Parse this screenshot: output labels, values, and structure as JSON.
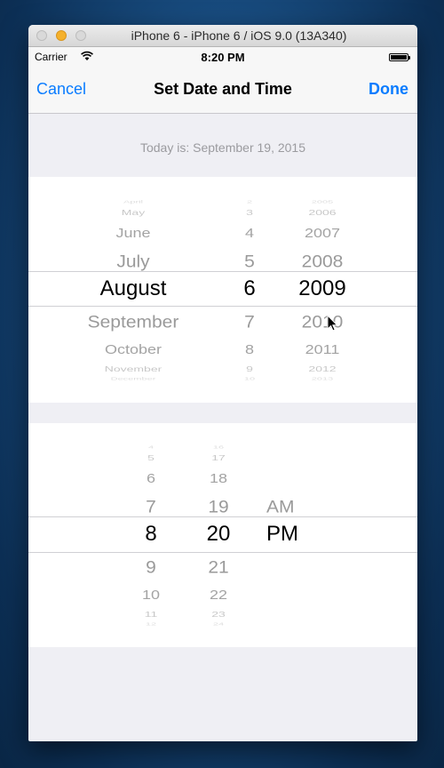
{
  "window": {
    "title": "iPhone 6 - iPhone 6 / iOS 9.0 (13A340)"
  },
  "status_bar": {
    "carrier": "Carrier",
    "time": "8:20 PM",
    "wifi_icon": "wifi-icon",
    "battery_icon": "battery-icon"
  },
  "nav": {
    "cancel": "Cancel",
    "title": "Set Date and Time",
    "done": "Done",
    "accent": "#0a7cff"
  },
  "today_label": "Today is: September 19, 2015",
  "date_picker": {
    "months": [
      "April",
      "May",
      "June",
      "July",
      "August",
      "September",
      "October",
      "November",
      "December"
    ],
    "days": [
      "2",
      "3",
      "4",
      "5",
      "6",
      "7",
      "8",
      "9",
      "10"
    ],
    "years": [
      "2005",
      "2006",
      "2007",
      "2008",
      "2009",
      "2010",
      "2011",
      "2012",
      "2013"
    ],
    "selected": {
      "month": "August",
      "day": "6",
      "year": "2009"
    }
  },
  "time_picker": {
    "hours": [
      "4",
      "5",
      "6",
      "7",
      "8",
      "9",
      "10",
      "11",
      "12"
    ],
    "minutes": [
      "16",
      "17",
      "18",
      "19",
      "20",
      "21",
      "22",
      "23",
      "24"
    ],
    "periods": [
      "",
      "",
      "",
      "AM",
      "PM",
      "",
      "",
      "",
      ""
    ],
    "selected": {
      "hour": "8",
      "minute": "20",
      "period": "PM"
    }
  }
}
